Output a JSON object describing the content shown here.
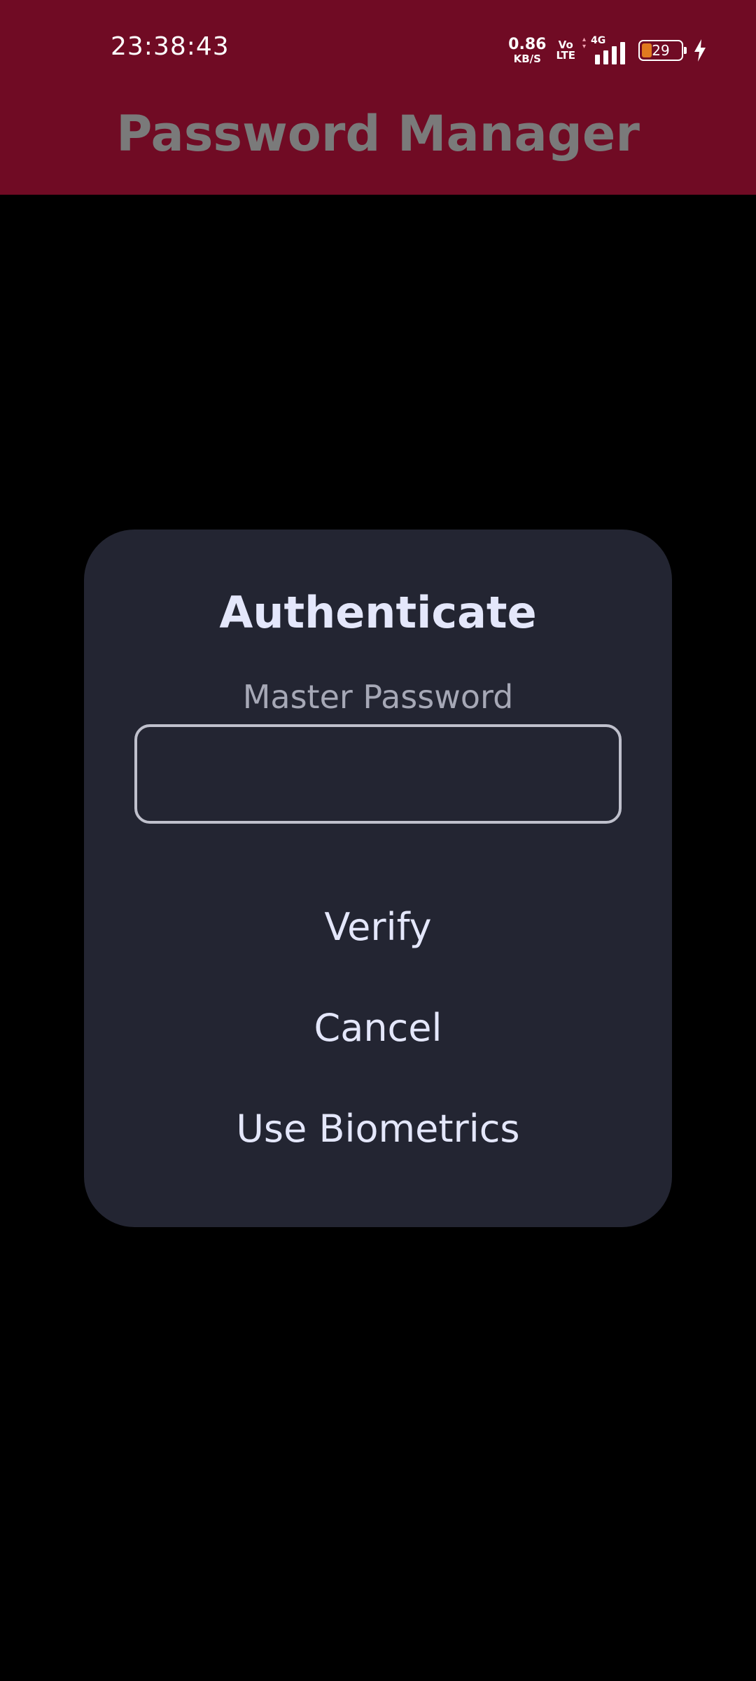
{
  "status_bar": {
    "time": "23:38:43",
    "net_speed_value": "0.86",
    "net_speed_unit": "KB/S",
    "volte_top": "Vo",
    "volte_bottom": "LTE",
    "network_type": "4G",
    "battery_level": "29",
    "charging_icon": "bolt-icon"
  },
  "app_bar": {
    "title": "Password Manager",
    "color": "#700b24"
  },
  "dialog": {
    "title": "Authenticate",
    "field_label": "Master Password",
    "password_value": "",
    "buttons": {
      "verify": "Verify",
      "cancel": "Cancel",
      "biometrics": "Use Biometrics"
    },
    "background": "#232532",
    "text_color": "#e4e7fb"
  }
}
